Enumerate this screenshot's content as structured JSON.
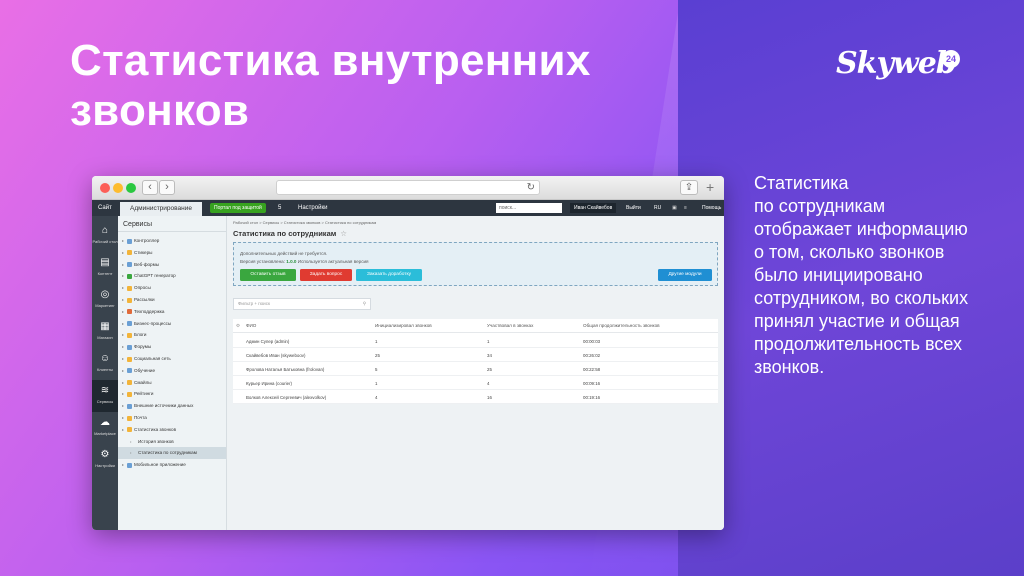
{
  "slide": {
    "title_line1": "Статистика внутренних",
    "title_line2": "звонков",
    "logo_text": "Skyweb",
    "logo_badge": "24",
    "description": [
      "Статистика",
      "по сотрудникам",
      "отображает информацию",
      "о том, сколько звонков",
      "было инициировано",
      "сотрудником, во скольких",
      "принял участие и общая",
      "продолжительность всех",
      "звонков."
    ]
  },
  "browser": {
    "back_glyph": "‹",
    "forward_glyph": "›",
    "reload_glyph": "↻",
    "share_glyph": "⇪",
    "new_tab_glyph": "+"
  },
  "topbar": {
    "site": "Сайт",
    "admin": "Администрирование",
    "green_button": "Портал под защитой",
    "count": "5",
    "settings": "Настройки",
    "search_placeholder": "поиск...",
    "user": "Иван Скайвебов",
    "logout": "Выйти",
    "lang": "RU",
    "help": "Помощь"
  },
  "iconbar": [
    {
      "glyph": "⌂",
      "label": "Рабочий стол",
      "icon": "home-icon"
    },
    {
      "glyph": "▤",
      "label": "Контент",
      "icon": "content-icon"
    },
    {
      "glyph": "◎",
      "label": "Маркетинг",
      "icon": "marketing-icon"
    },
    {
      "glyph": "▦",
      "label": "Магазин",
      "icon": "shop-icon"
    },
    {
      "glyph": "☺",
      "label": "Клиенты",
      "icon": "clients-icon"
    },
    {
      "glyph": "≋",
      "label": "Сервисы",
      "icon": "services-icon"
    },
    {
      "glyph": "☁",
      "label": "Marketplace",
      "icon": "marketplace-icon"
    },
    {
      "glyph": "⚙",
      "label": "Настройки",
      "icon": "settings-icon"
    }
  ],
  "tree": {
    "title": "Сервисы",
    "items": [
      {
        "label": "Контроллер",
        "color": "#6a9fd4"
      },
      {
        "label": "Стикеры",
        "color": "#f2b43a"
      },
      {
        "label": "Веб-формы",
        "color": "#6a9fd4"
      },
      {
        "label": "ChatGPT генератор",
        "color": "#3aa73f"
      },
      {
        "label": "Опросы",
        "color": "#f2b43a"
      },
      {
        "label": "Рассылки",
        "color": "#f2b43a"
      },
      {
        "label": "Техподдержка",
        "color": "#e06a3a"
      },
      {
        "label": "Бизнес-процессы",
        "color": "#6a9fd4"
      },
      {
        "label": "Блоги",
        "color": "#f2b43a"
      },
      {
        "label": "Форумы",
        "color": "#6a9fd4"
      },
      {
        "label": "Социальная сеть",
        "color": "#f2b43a"
      },
      {
        "label": "Обучение",
        "color": "#6a9fd4"
      },
      {
        "label": "Смайлы",
        "color": "#f2b43a"
      },
      {
        "label": "Рейтинги",
        "color": "#f2b43a"
      },
      {
        "label": "Внешние источники данных",
        "color": "#6a9fd4"
      },
      {
        "label": "Почта",
        "color": "#f2b43a"
      },
      {
        "label": "Статистика звонков",
        "color": "#f2b43a"
      },
      {
        "label": "История звонков",
        "sub": true
      },
      {
        "label": "Статистика по сотрудникам",
        "sub": true,
        "selected": true
      },
      {
        "label": "Мобильное приложение",
        "color": "#6a9fd4"
      }
    ]
  },
  "main": {
    "breadcrumbs": "Рабочий стол  >  Сервисы  >  Статистика звонков  >  Статистика по сотрудникам",
    "page_title": "Статистика по сотрудникам",
    "star": "☆",
    "info_line1": "Дополнительных действий не требуется.",
    "info_line2_prefix": "Версия установлена:",
    "info_version": "1.0.0",
    "info_line2_suffix": "Используется актуальная версия",
    "buttons": {
      "feedback": "Оставить отзыв",
      "ask": "Задать вопрос",
      "order": "Заказать доработку",
      "modules": "Другие модули"
    },
    "filter_placeholder": "Фильтр + поиск",
    "columns": [
      "ФИО",
      "Инициализировал звонков",
      "Участвовал в звонках",
      "Общая продолжительность звонков"
    ],
    "rows": [
      [
        "Админ Супер (admin)",
        "1",
        "1",
        "00:00:03"
      ],
      [
        "Скайвебов Иван (skyweboov)",
        "25",
        "34",
        "00:26:02"
      ],
      [
        "Фролова Наталья Батьковна (frolovan)",
        "5",
        "25",
        "00:22:58"
      ],
      [
        "Курьер Ирина (courier)",
        "1",
        "4",
        "00:09:16"
      ],
      [
        "Волков Алексей Сергеевич (alexvolkov)",
        "4",
        "16",
        "00:19:16"
      ]
    ]
  }
}
